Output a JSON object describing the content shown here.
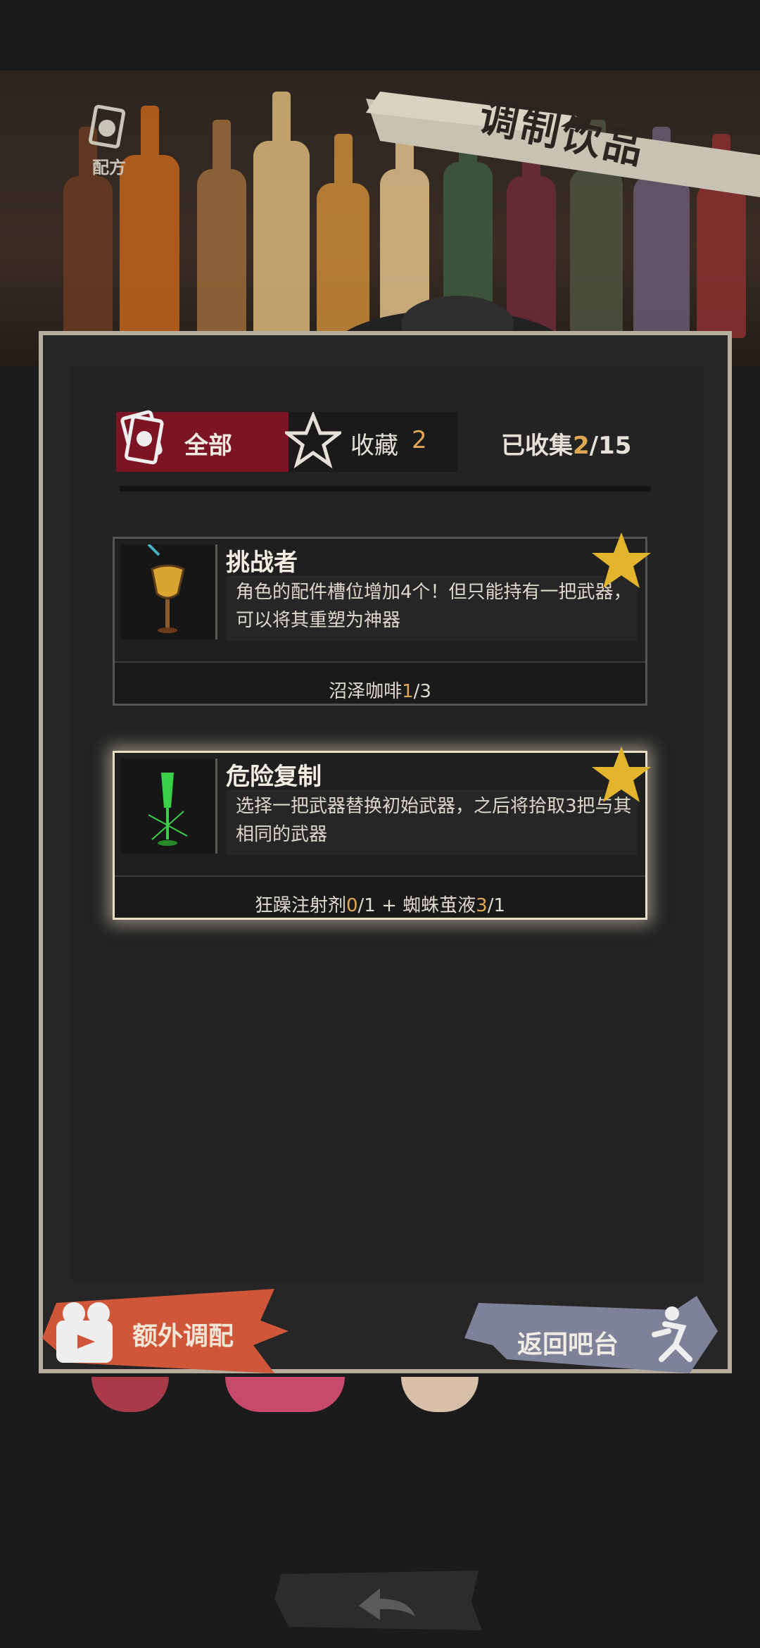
{
  "header": {
    "title": "调制饮品",
    "recipe_label": "配方"
  },
  "tabs": {
    "all_label": "全部",
    "favorites_label": "收藏",
    "favorites_count": "2",
    "collected_prefix": "已收集",
    "collected_count": "2",
    "collected_total": "/15"
  },
  "cards": [
    {
      "name": "挑战者",
      "description": "角色的配件槽位增加4个！但只能持有一把武器，可以将其重塑为神器",
      "recipe_parts": [
        {
          "text": "沼泽咖啡"
        },
        {
          "text": "1",
          "highlight": true
        },
        {
          "text": "/3"
        }
      ],
      "favorited": true
    },
    {
      "name": "危险复制",
      "description": "选择一把武器替换初始武器，之后将拾取3把与其相同的武器",
      "recipe_parts": [
        {
          "text": "狂躁注射剂"
        },
        {
          "text": "0",
          "highlight": true
        },
        {
          "text": "/1 + 蜘蛛茧液"
        },
        {
          "text": "3",
          "highlight": true
        },
        {
          "text": "/1"
        }
      ],
      "favorited": true,
      "selected": true
    }
  ],
  "buttons": {
    "extra_mix": "额外调配",
    "back_to_bar": "返回吧台"
  },
  "colors": {
    "accent": "#e0a856",
    "tab_active": "#7c1424",
    "star": "#e3b52c",
    "extra_button": "#d0563a",
    "back_button": "#7d8298"
  },
  "icons": {
    "recipe": "recipe-card-icon",
    "all": "cards-icon",
    "favorite": "star-outline-icon",
    "favorited": "star-filled-icon",
    "extra": "camera-icon",
    "back_bar": "running-person-icon",
    "back": "back-arrow-icon"
  }
}
